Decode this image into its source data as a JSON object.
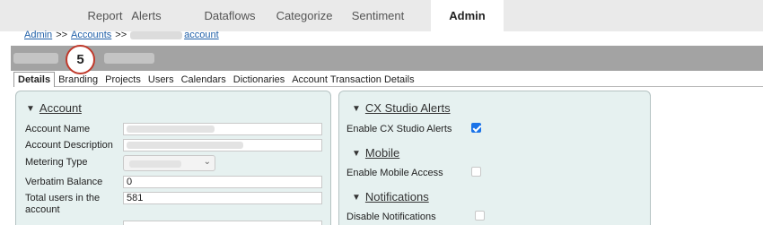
{
  "nav": {
    "tabs": [
      {
        "label": "Report"
      },
      {
        "label": "Alerts"
      },
      {
        "label": "Dataflows"
      },
      {
        "label": "Categorize"
      },
      {
        "label": "Sentiment"
      },
      {
        "label": "Admin",
        "active": true
      }
    ]
  },
  "breadcrumb": {
    "items": [
      "Admin",
      "Accounts",
      "account"
    ],
    "separator": ">>"
  },
  "step_badge": "5",
  "subtabs": [
    "Details",
    "Branding",
    "Projects",
    "Users",
    "Calendars",
    "Dictionaries",
    "Account Transaction Details"
  ],
  "account": {
    "heading": "Account",
    "fields": {
      "name_label": "Account Name",
      "description_label": "Account Description",
      "metering_label": "Metering Type",
      "verbatim_label": "Verbatim Balance",
      "verbatim_value": "0",
      "total_users_label_1": "Total users in the",
      "total_users_label_2": "account",
      "total_users_value": "581"
    }
  },
  "right_panel": {
    "alerts_heading": "CX Studio Alerts",
    "enable_alerts_label": "Enable CX Studio Alerts",
    "enable_alerts_checked": true,
    "mobile_heading": "Mobile",
    "enable_mobile_label": "Enable Mobile Access",
    "enable_mobile_checked": false,
    "notifications_heading": "Notifications",
    "disable_notifications_label": "Disable Notifications",
    "disable_notifications_checked": false
  },
  "colors": {
    "panel_bg": "#e6f1f0",
    "link": "#1f5fa8",
    "title_bar": "#a3a3a3",
    "badge_ring": "#c0392b",
    "checkbox_checked": "#1a73e8"
  }
}
